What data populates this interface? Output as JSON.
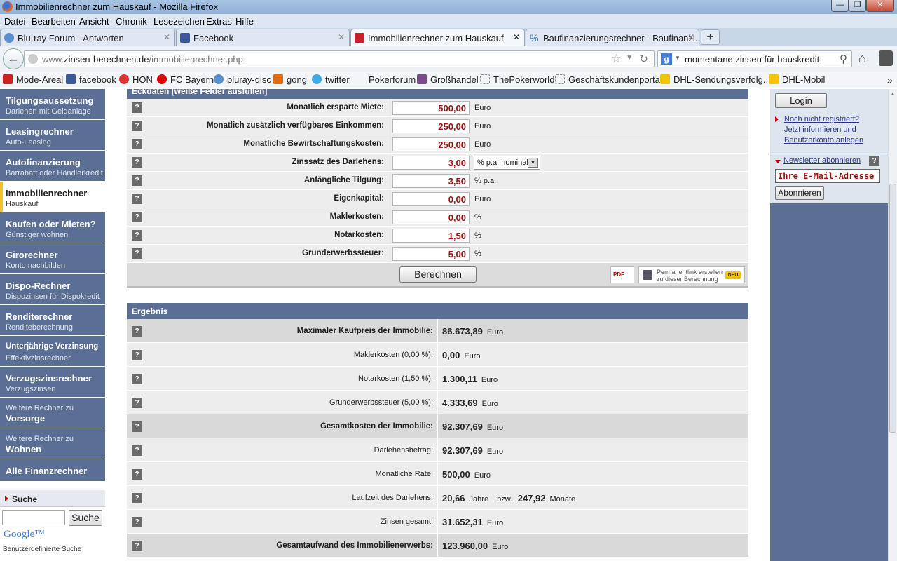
{
  "window": {
    "title": "Immobilienrechner zum Hauskauf - Mozilla Firefox"
  },
  "menu": [
    "Datei",
    "Bearbeiten",
    "Ansicht",
    "Chronik",
    "Lesezeichen",
    "Extras",
    "Hilfe"
  ],
  "tabs": [
    {
      "label": "Blu-ray Forum - Antworten",
      "icon": "bluray-icon"
    },
    {
      "label": "Facebook",
      "icon": "facebook-icon"
    },
    {
      "label": "Immobilienrechner zum Hauskauf",
      "icon": "zinsen-icon",
      "active": true
    },
    {
      "label": "Baufinanzierungsrechner - Baufinanzi...",
      "icon": "percent-icon"
    }
  ],
  "newtab": "+",
  "address": {
    "prefix": "www.",
    "domain": "zinsen-berechnen.de",
    "path": "/immobilienrechner.php"
  },
  "search": {
    "value": "momentane zinsen für hauskredit"
  },
  "bookmarks": [
    "Mode-Areal",
    "facebook",
    "HON",
    "FC Bayern",
    "bluray-disc",
    "gong",
    "twitter",
    "Pokerforum",
    "Großhandel",
    "ThePokerworld",
    "Geschäftskundenportal",
    "DHL-Sendungsverfolg...",
    "DHL-Mobil"
  ],
  "sidebar": {
    "items": [
      {
        "title": "Tilgungsaussetzung",
        "sub": "Darlehen mit Geldanlage"
      },
      {
        "title": "Leasingrechner",
        "sub": "Auto-Leasing"
      },
      {
        "title": "Autofinanzierung",
        "sub": "Barrabatt oder Händlerkredit"
      },
      {
        "title": "Immobilienrechner",
        "sub": "Hauskauf"
      },
      {
        "title": "Kaufen oder Mieten?",
        "sub": "Günstiger wohnen"
      },
      {
        "title": "Girorechner",
        "sub": "Konto nachbilden"
      },
      {
        "title": "Dispo-Rechner",
        "sub": "Dispozinsen für Dispokredit"
      },
      {
        "title": "Renditerechner",
        "sub": "Renditeberechnung"
      },
      {
        "title": "Unterjährige Verzinsung",
        "sub": "Effektivzinsrechner"
      },
      {
        "title": "Verzugszinsrechner",
        "sub": "Verzugszinsen"
      },
      {
        "pre": "Weitere Rechner zu",
        "title": "Vorsorge"
      },
      {
        "pre": "Weitere Rechner zu",
        "title": "Wohnen"
      },
      {
        "title": "Alle Finanzrechner"
      }
    ],
    "search_title": "Suche",
    "search_button": "Suche",
    "google": "Google™",
    "custom_search": "Benutzerdefinierte Suche"
  },
  "form": {
    "header": "Eckdaten  [weiße Felder ausfüllen]",
    "rows": [
      {
        "label": "Monatlich ersparte Miete:",
        "value": "500,00",
        "unit": "Euro"
      },
      {
        "label": "Monatlich zusätzlich verfügbares Einkommen:",
        "value": "250,00",
        "unit": "Euro"
      },
      {
        "label": "Monatliche Bewirtschaftungskosten:",
        "value": "250,00",
        "unit": "Euro"
      },
      {
        "label": "Zinssatz des Darlehens:",
        "value": "3,00",
        "unit": "% p.a. nominal",
        "select": true
      },
      {
        "label": "Anfängliche Tilgung:",
        "value": "3,50",
        "unit": "% p.a."
      },
      {
        "label": "Eigenkapital:",
        "value": "0,00",
        "unit": "Euro"
      },
      {
        "label": "Maklerkosten:",
        "value": "0,00",
        "unit": "%"
      },
      {
        "label": "Notarkosten:",
        "value": "1,50",
        "unit": "%"
      },
      {
        "label": "Grunderwerbssteuer:",
        "value": "5,00",
        "unit": "%"
      }
    ],
    "calc_button": "Berechnen",
    "pdf_label": "PDF",
    "permalink": [
      "Permanentlink erstellen",
      "zu dieser Berechnung"
    ],
    "neu_badge": "NEU"
  },
  "result": {
    "header": "Ergebnis",
    "rows": [
      {
        "label": "Maximaler Kaufpreis der Immobilie:",
        "value": "86.673,89",
        "unit": "Euro",
        "bold": true
      },
      {
        "label": "Maklerkosten (0,00 %):",
        "value": "0,00",
        "unit": "Euro"
      },
      {
        "label": "Notarkosten (1,50 %):",
        "value": "1.300,11",
        "unit": "Euro"
      },
      {
        "label": "Grunderwerbssteuer (5,00 %):",
        "value": "4.333,69",
        "unit": "Euro"
      },
      {
        "label": "Gesamtkosten der Immobilie:",
        "value": "92.307,69",
        "unit": "Euro",
        "bold": true
      },
      {
        "label": "Darlehensbetrag:",
        "value": "92.307,69",
        "unit": "Euro"
      },
      {
        "label": "Monatliche Rate:",
        "value": "500,00",
        "unit": "Euro"
      },
      {
        "label": "Laufzeit des Darlehens:",
        "value": "20,66",
        "unit": "Jahre",
        "alt_pre": "bzw.",
        "alt_value": "247,92",
        "alt_unit": "Monate"
      },
      {
        "label": "Zinsen gesamt:",
        "value": "31.652,31",
        "unit": "Euro"
      },
      {
        "label": "Gesamtaufwand des Immobilienerwerbs:",
        "value": "123.960,00",
        "unit": "Euro",
        "bold": true
      }
    ]
  },
  "right": {
    "login_button": "Login",
    "register_lines": [
      "Noch nicht registriert?",
      "Jetzt informieren und",
      "Benutzerkonto anlegen"
    ],
    "newsletter_link": "Newsletter abonnieren",
    "email_placeholder": "Ihre E-Mail-Adresse",
    "subscribe_button": "Abonnieren"
  },
  "question_mark": "?"
}
